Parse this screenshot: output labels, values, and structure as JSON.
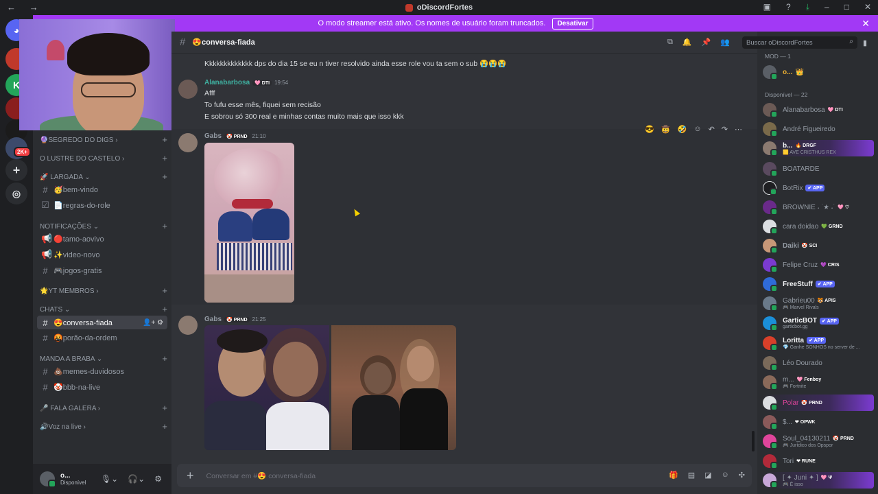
{
  "titlebar": {
    "title": "oDiscordFortes"
  },
  "banner": {
    "text": "O modo streamer está ativo. Os nomes de usuário foram truncados.",
    "button": "Desativar"
  },
  "rail": {
    "badge": "2K+"
  },
  "sidebar": {
    "categories": [
      {
        "label": "🔮SEGREDO DO DIGS ›"
      },
      {
        "label": "O LUSTRE DO CASTELO ›"
      },
      {
        "label": "🚀 LARGADA ⌄"
      },
      {
        "label": "NOTIFICAÇÕES ⌄"
      },
      {
        "label": "🌟YT MEMBROS ›"
      },
      {
        "label": "CHATS ⌄"
      },
      {
        "label": "MANDA A BRABA ⌄"
      },
      {
        "label": "🎤 FALA GALERA ›"
      },
      {
        "label": "🔊Voz na live ›"
      }
    ],
    "channels": [
      {
        "label": "🥳bem-vindo"
      },
      {
        "label": "📄regras-do-role"
      },
      {
        "label": "🔴tamo-aovivo"
      },
      {
        "label": "✨video-novo"
      },
      {
        "label": "🎮jogos-gratis"
      },
      {
        "label": "😍conversa-fiada"
      },
      {
        "label": "🤬porão-da-ordem"
      },
      {
        "label": "💩memes-duvidosos"
      },
      {
        "label": "🤡bbb-na-live"
      }
    ],
    "user": {
      "name": "o...",
      "status": "Disponível"
    }
  },
  "channel": {
    "name": "😍conversa-fiada",
    "search_placeholder": "Buscar oDiscordFortes",
    "composer_placeholder": "Conversar em #😍 conversa-fiada"
  },
  "messages": {
    "m0": {
      "text": "Kkkkkkkkkkkkk dps do dia 15 se eu n tiver resolvido ainda esse role vou ta sem o sub 😭😭😭"
    },
    "m1": {
      "author": "Alanabarbosa",
      "tag": "🩷 DTI",
      "time": "19:54",
      "lines": [
        "Afff",
        "To fufu esse mês, fiquei sem recisão",
        "E sobrou só 300 real e minhas contas muito mais que isso kkk"
      ]
    },
    "m2": {
      "author": "Gabs",
      "tag": "🤡 PRND",
      "time": "21:10"
    },
    "m3": {
      "author": "Gabs",
      "tag": "🤡 PRND",
      "time": "21:25"
    }
  },
  "members": {
    "groups": {
      "mod": "MOD — 1",
      "available": "Disponível — 22"
    },
    "list": [
      {
        "name": "o...",
        "tag": "👑",
        "color": "#f0b232"
      },
      {
        "name": "Alanabarbosa",
        "tag": "🩷 DTI",
        "color": "#949ba4"
      },
      {
        "name": "André Figueiredo",
        "tag": "",
        "color": "#949ba4"
      },
      {
        "name": "b...",
        "tag": "🔥 DRGF",
        "sub": "🟨 AVE CRISTHUS REX",
        "color": "#f2f3f5"
      },
      {
        "name": "BOATARDE",
        "tag": "",
        "color": "#949ba4"
      },
      {
        "name": "BotRix",
        "tag": "✔ APP",
        "color": "#949ba4"
      },
      {
        "name": "BROWNIE ˖ ࣪ ★ ˖ ࣪",
        "tag": "🩷 ♡",
        "color": "#949ba4"
      },
      {
        "name": "cara doidao",
        "tag": "💚 GRND",
        "color": "#949ba4"
      },
      {
        "name": "Daiki",
        "tag": "🤡 SCI",
        "color": "#949ba4"
      },
      {
        "name": "Felipe Cruz",
        "tag": "💜 CRIS",
        "color": "#949ba4"
      },
      {
        "name": "FreeStuff",
        "tag": "✔ APP",
        "color": "#f2f3f5"
      },
      {
        "name": "Gabrieu00",
        "tag": "🐯 APIS",
        "sub": "🎮 Marvel Rivals",
        "color": "#949ba4"
      },
      {
        "name": "GarticBOT",
        "tag": "✔ APP",
        "sub": "garticbot.gg",
        "color": "#f2f3f5"
      },
      {
        "name": "Loritta",
        "tag": "✔ APP",
        "sub": "💎 Ganhe SONHOS no server de ...",
        "color": "#f2f3f5"
      },
      {
        "name": "Léo Dourado",
        "tag": "",
        "color": "#949ba4"
      },
      {
        "name": "m...",
        "tag": "🩷 Fenboy",
        "sub": "🎮 Fortnite",
        "color": "#949ba4"
      },
      {
        "name": "Polar",
        "tag": "🤡 PRND",
        "color": "#e0459b"
      },
      {
        "name": "$...",
        "tag": "❤ OPWK",
        "color": "#949ba4"
      },
      {
        "name": "Soul_04130211",
        "tag": "🤡 PRND",
        "sub": "🎮 Jurídico dos Opspor",
        "color": "#949ba4"
      },
      {
        "name": "Tori",
        "tag": "❤ RUNE",
        "color": "#949ba4"
      },
      {
        "name": "[ ✦ Juni ✦ ]",
        "tag": "🩷 Ψ",
        "sub": "🎮 É isso",
        "color": "#949ba4"
      }
    ]
  },
  "colors": {
    "accent": "#a239f5",
    "online": "#23a55a",
    "author": "#3fb0a0",
    "background": "#313338"
  }
}
